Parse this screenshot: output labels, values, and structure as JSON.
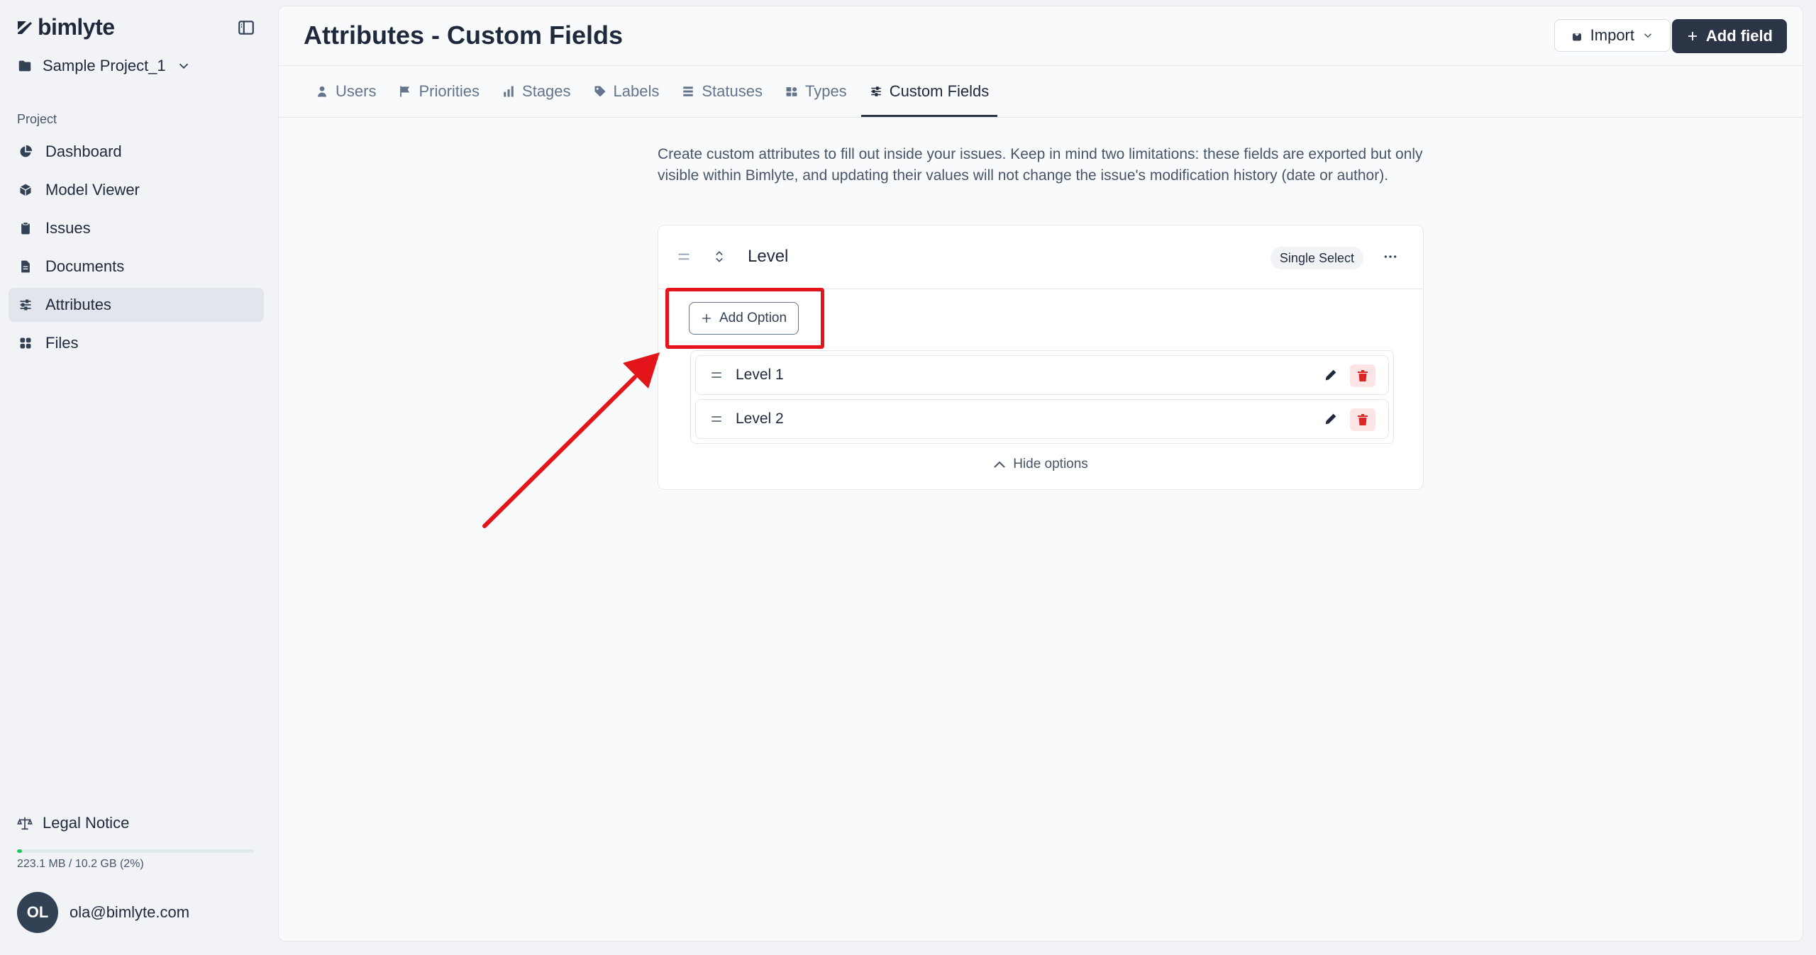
{
  "app": {
    "logo_text": "bimlyte",
    "project_name": "Sample Project_1"
  },
  "sidebar": {
    "section_label": "Project",
    "items": [
      {
        "label": "Dashboard",
        "icon": "pie-chart-icon"
      },
      {
        "label": "Model Viewer",
        "icon": "cube-icon"
      },
      {
        "label": "Issues",
        "icon": "clipboard-icon"
      },
      {
        "label": "Documents",
        "icon": "document-icon"
      },
      {
        "label": "Attributes",
        "icon": "sliders-icon",
        "active": true
      },
      {
        "label": "Files",
        "icon": "grid-icon"
      }
    ],
    "legal_label": "Legal Notice",
    "storage_text": "223.1 MB / 10.2 GB (2%)",
    "storage_percent": 2,
    "user_initials": "OL",
    "user_email": "ola@bimlyte.com"
  },
  "header": {
    "title": "Attributes - Custom Fields",
    "import_label": "Import",
    "add_field_label": "Add field"
  },
  "tabs": [
    {
      "label": "Users",
      "icon": "user-icon"
    },
    {
      "label": "Priorities",
      "icon": "flag-icon"
    },
    {
      "label": "Stages",
      "icon": "bar-chart-icon"
    },
    {
      "label": "Labels",
      "icon": "tag-icon"
    },
    {
      "label": "Statuses",
      "icon": "list-icon"
    },
    {
      "label": "Types",
      "icon": "shapes-icon"
    },
    {
      "label": "Custom Fields",
      "icon": "sliders-icon",
      "active": true
    }
  ],
  "description": "Create custom attributes to fill out inside your issues. Keep in mind two limitations: these fields are exported but only visible within Bimlyte, and updating their values will not change the issue's modification history (date or author).",
  "field": {
    "name": "Level",
    "type": "Single Select",
    "add_option_label": "Add Option",
    "options": [
      {
        "label": "Level 1"
      },
      {
        "label": "Level 2"
      }
    ],
    "hide_options_label": "Hide options"
  },
  "colors": {
    "accent_dark": "#2b3545",
    "highlight_red": "#e3151a",
    "storage_green": "#22c55e",
    "delete_red": "#dc2626"
  }
}
